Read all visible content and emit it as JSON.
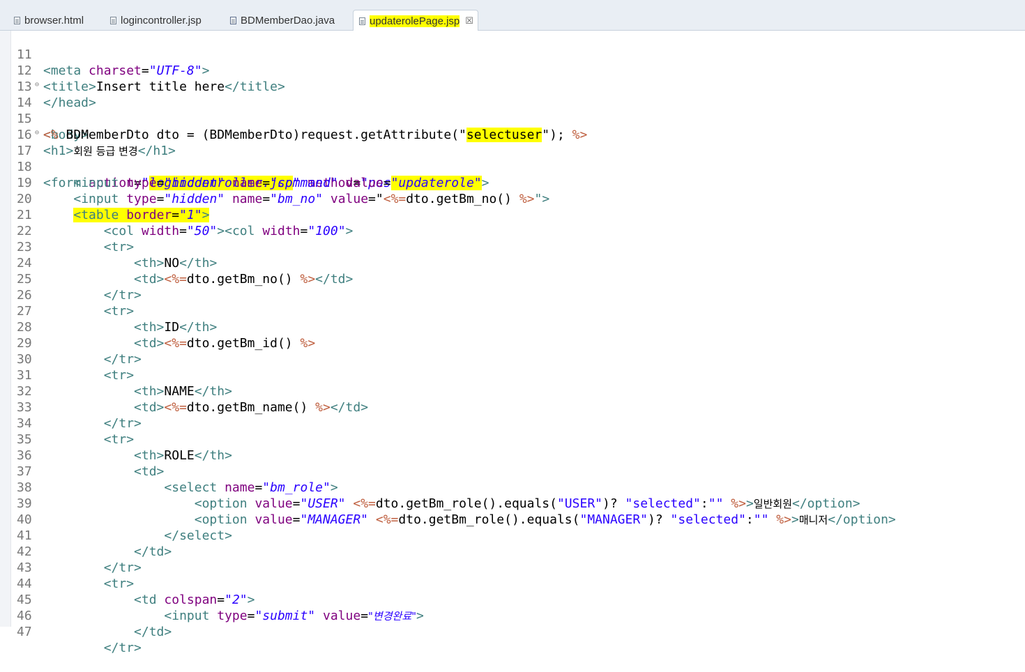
{
  "tabs": [
    {
      "label": "browser.html",
      "icon": "html-file-icon",
      "active": false
    },
    {
      "label": "logincontroller.jsp",
      "icon": "jsp-file-icon",
      "active": false
    },
    {
      "label": "BDMemberDao.java",
      "icon": "java-file-icon",
      "active": false
    },
    {
      "label": "updaterolePage.jsp",
      "icon": "jsp-file-icon",
      "active": true
    }
  ],
  "close_glyph": "☒",
  "highlight_color": "#ffff00",
  "editor": {
    "line_numbers": [
      "11",
      "12",
      "13",
      "14",
      "15",
      "16",
      "17",
      "18",
      "19",
      "20",
      "21",
      "22",
      "23",
      "24",
      "25",
      "26",
      "27",
      "28",
      "29",
      "30",
      "31",
      "32",
      "33",
      "34",
      "35",
      "36",
      "37",
      "38",
      "39",
      "40",
      "41",
      "42",
      "43",
      "44",
      "45",
      "46",
      "47"
    ],
    "lines": {
      "l11": {
        "p1": "<meta ",
        "p2": "charset",
        "p3": "=",
        "p4": "\"UTF-8\"",
        "p5": ">"
      },
      "l12": {
        "p1": "<title>",
        "p2": "Insert title here",
        "p3": "</title>"
      },
      "l13": {
        "p1": "</head>"
      },
      "l14": {
        "p1": "<body>"
      },
      "l15": {
        "p1": "<%",
        "p2": " BDMemberDto dto = (BDMemberDto)request.getAttribute(\"",
        "p3": "selectuser",
        "p4": "\"); ",
        "p5": "%>"
      },
      "l16": {
        "p1": "<h1>",
        "p2": "회원 등급 변경",
        "p3": "</h1>"
      },
      "l17": {
        "p1": "<form ",
        "p2": "action",
        "p3": "=",
        "p4": "\"",
        "p5": "logincontroller.jsp",
        "p6": "\"",
        "p7": " method",
        "p8": "=",
        "p9": "\"post\"",
        "p10": ">"
      },
      "l18": {
        "p1": "<input ",
        "p2": "type",
        "p3": "=",
        "p4": "\"hidden\"",
        "p5": " name",
        "p6": "=",
        "p7": "\"command\"",
        "p8": " value",
        "p9": "=",
        "p10": "\"updaterole\"",
        "p11": ">"
      },
      "l19": {
        "p1": "<input ",
        "p2": "type",
        "p3": "=",
        "p4": "\"hidden\"",
        "p5": " name",
        "p6": "=",
        "p7": "\"bm_no\"",
        "p8": " value",
        "p9": "=\"",
        "p10": "<%=",
        "p11": "dto.getBm_no() ",
        "p12": "%>",
        "p13": "\">"
      },
      "l20": {
        "p1": "<table ",
        "p2": "border",
        "p3": "=",
        "p4": "\"1\"",
        "p5": ">"
      },
      "l21": {
        "p1": "<col ",
        "p2": "width",
        "p3": "=",
        "p4": "\"50\"",
        "p5": "><col ",
        "p6": "width",
        "p7": "=",
        "p8": "\"100\"",
        "p9": ">"
      },
      "l22": {
        "p1": "<tr>"
      },
      "l23": {
        "p1": "<th>",
        "p2": "NO",
        "p3": "</th>"
      },
      "l24": {
        "p1": "<td>",
        "p2": "<%=",
        "p3": "dto.getBm_no() ",
        "p4": "%>",
        "p5": "</td>"
      },
      "l25": {
        "p1": "</tr>"
      },
      "l26": {
        "p1": "<tr>"
      },
      "l27": {
        "p1": "<th>",
        "p2": "ID",
        "p3": "</th>"
      },
      "l28": {
        "p1": "<td>",
        "p2": "<%=",
        "p3": "dto.getBm_id() ",
        "p4": "%>"
      },
      "l29": {
        "p1": "</tr>"
      },
      "l30": {
        "p1": "<tr>"
      },
      "l31": {
        "p1": "<th>",
        "p2": "NAME",
        "p3": "</th>"
      },
      "l32": {
        "p1": "<td>",
        "p2": "<%=",
        "p3": "dto.getBm_name() ",
        "p4": "%>",
        "p5": "</td>"
      },
      "l33": {
        "p1": "</tr>"
      },
      "l34": {
        "p1": "<tr>"
      },
      "l35": {
        "p1": "<th>",
        "p2": "ROLE",
        "p3": "</th>"
      },
      "l36": {
        "p1": "<td>"
      },
      "l37": {
        "p1": "<select ",
        "p2": "name",
        "p3": "=",
        "p4": "\"bm_role\"",
        "p5": ">"
      },
      "l38": {
        "p1": "<option ",
        "p2": "value",
        "p3": "=",
        "p4": "\"USER\"",
        "p5": " ",
        "p6": "<%=",
        "p7": "dto.getBm_role().equals(",
        "p8": "\"USER\"",
        "p9": ")? ",
        "p10": "\"selected\"",
        "p11": ":",
        "p12": "\"\"",
        "p13": " ",
        "p14": "%>",
        "p15": ">",
        "p16": "일반회원",
        "p17": "</option>"
      },
      "l39": {
        "p1": "<option ",
        "p2": "value",
        "p3": "=",
        "p4": "\"MANAGER\"",
        "p5": " ",
        "p6": "<%=",
        "p7": "dto.getBm_role().equals(",
        "p8": "\"MANAGER\"",
        "p9": ")? ",
        "p10": "\"selected\"",
        "p11": ":",
        "p12": "\"\"",
        "p13": " ",
        "p14": "%>",
        "p15": ">",
        "p16": "매니저",
        "p17": "</option>"
      },
      "l40": {
        "p1": "</select>"
      },
      "l41": {
        "p1": "</td>"
      },
      "l42": {
        "p1": "</tr>"
      },
      "l43": {
        "p1": "<tr>"
      },
      "l44": {
        "p1": "<td ",
        "p2": "colspan",
        "p3": "=",
        "p4": "\"2\"",
        "p5": ">"
      },
      "l45": {
        "p1": "<input ",
        "p2": "type",
        "p3": "=",
        "p4": "\"submit\"",
        "p5": " value",
        "p6": "=",
        "p7": "\"변경완료\"",
        "p8": ">"
      },
      "l46": {
        "p1": "</td>"
      },
      "l47": {
        "p1": "</tr>"
      }
    }
  }
}
